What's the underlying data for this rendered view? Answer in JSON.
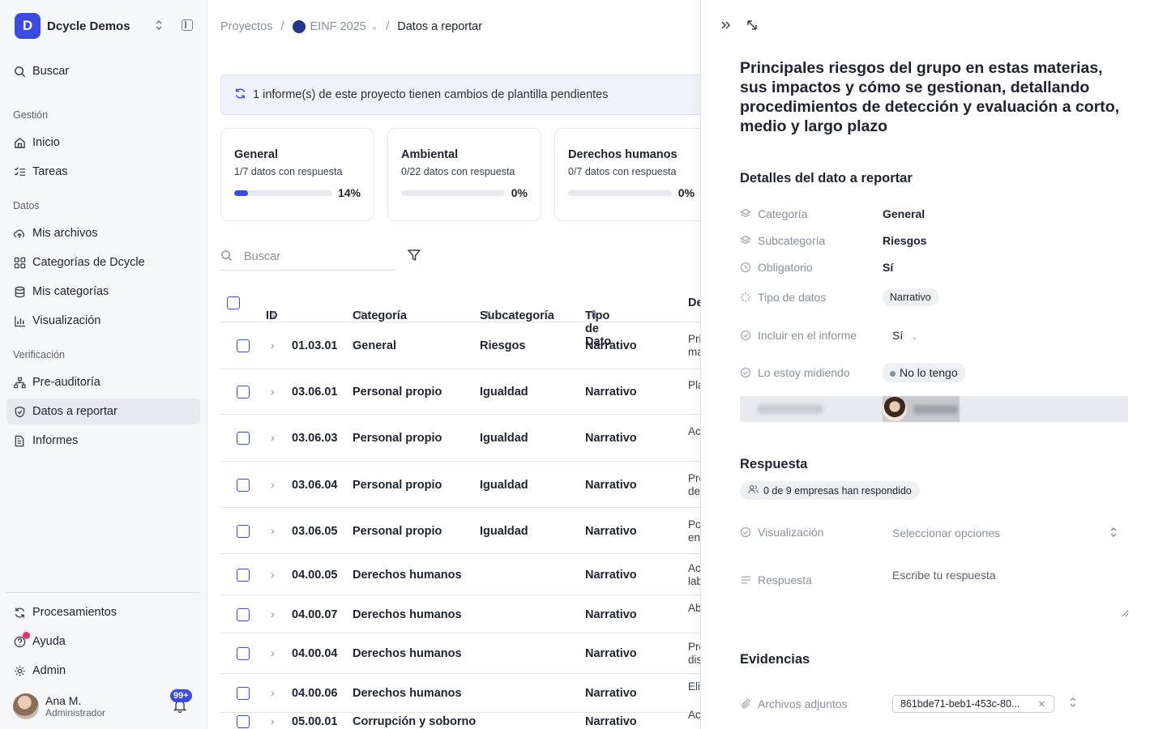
{
  "sidebar": {
    "brand": "Dcycle Demos",
    "brand_logo": "D",
    "search": "Buscar",
    "sections": [
      "Gestión",
      "Datos",
      "Verificación"
    ],
    "items": [
      {
        "label": "Inicio",
        "icon": "home-icon"
      },
      {
        "label": "Tareas",
        "icon": "checklist-icon"
      },
      {
        "label": "Mis archivos",
        "icon": "upload-cloud-icon"
      },
      {
        "label": "Categorías de Dcycle",
        "icon": "grid-icon"
      },
      {
        "label": "Mis categorías",
        "icon": "database-icon"
      },
      {
        "label": "Visualización",
        "icon": "bar-chart-icon"
      },
      {
        "label": "Pre-auditoría",
        "icon": "network-icon"
      },
      {
        "label": "Datos a reportar",
        "icon": "shield-check-icon"
      },
      {
        "label": "Informes",
        "icon": "document-icon"
      }
    ],
    "bottom": [
      {
        "label": "Procesamientos",
        "icon": "refresh-icon"
      },
      {
        "label": "Ayuda",
        "icon": "help-icon"
      },
      {
        "label": "Admin",
        "icon": "gear-icon"
      }
    ],
    "user": {
      "name": "Ana M.",
      "role": "Administrador",
      "notifications": "99+"
    }
  },
  "breadcrumb": {
    "root": "Proyectos",
    "project": "EINF 2025",
    "current": "Datos a reportar"
  },
  "notice": "1 informe(s) de este proyecto tienen cambios de plantilla pendientes",
  "cards": [
    {
      "title": "General",
      "sub": "1/7 datos con respuesta",
      "pct_label": "14%",
      "progress": 0.14
    },
    {
      "title": "Ambiental",
      "sub": "0/22 datos con respuesta",
      "pct_label": "0%",
      "progress": 0
    },
    {
      "title": "Derechos humanos",
      "sub": "0/7 datos con respuesta",
      "pct_label": "0%",
      "progress": 0
    }
  ],
  "search": {
    "placeholder": "Buscar"
  },
  "table": {
    "headers": {
      "id": "ID",
      "categoria": "Categoría",
      "subcategoria": "Subcategoría",
      "tipo": "Tipo de Dato",
      "desc": "De"
    },
    "rows": [
      {
        "id": "01.03.01",
        "categoria": "General",
        "subcategoria": "Riesgos",
        "tipo": "Narrativo",
        "desc": "Pri ma"
      },
      {
        "id": "03.06.01",
        "categoria": "Personal propio",
        "subcategoria": "Igualdad",
        "tipo": "Narrativo",
        "desc": "Pla"
      },
      {
        "id": "03.06.03",
        "categoria": "Personal propio",
        "subcategoria": "Igualdad",
        "tipo": "Narrativo",
        "desc": "Ac"
      },
      {
        "id": "03.06.04",
        "categoria": "Personal propio",
        "subcategoria": "Igualdad",
        "tipo": "Narrativo",
        "desc": "Pro de"
      },
      {
        "id": "03.06.05",
        "categoria": "Personal propio",
        "subcategoria": "Igualdad",
        "tipo": "Narrativo",
        "desc": "Po en"
      },
      {
        "id": "04.00.05",
        "categoria": "Derechos humanos",
        "subcategoria": "",
        "tipo": "Narrativo",
        "desc": "Ac lab"
      },
      {
        "id": "04.00.07",
        "categoria": "Derechos humanos",
        "subcategoria": "",
        "tipo": "Narrativo",
        "desc": "Ab"
      },
      {
        "id": "04.00.04",
        "categoria": "Derechos humanos",
        "subcategoria": "",
        "tipo": "Narrativo",
        "desc": "Pro dis"
      },
      {
        "id": "04.00.06",
        "categoria": "Derechos humanos",
        "subcategoria": "",
        "tipo": "Narrativo",
        "desc": "Eli"
      },
      {
        "id": "05.00.01",
        "categoria": "Corrupción y soborno",
        "subcategoria": "",
        "tipo": "Narrativo",
        "desc": "Ac"
      }
    ]
  },
  "panel": {
    "title": "Principales riesgos del grupo en estas materias, sus impactos y cómo se gestionan, detallando procedimientos de detección y evaluación a corto, medio y largo plazo",
    "details_heading": "Detalles del dato a reportar",
    "fields": {
      "categoria_label": "Categoría",
      "categoria": "General",
      "subcategoria_label": "Subcategoría",
      "subcategoria": "Riesgos",
      "obligatorio_label": "Obligatorio",
      "obligatorio": "Sí",
      "tipo_label": "Tipo de datos",
      "tipo": "Narrativo",
      "incluir_label": "Incluir en el informe",
      "incluir": "Sí",
      "midiendo_label": "Lo estoy midiendo",
      "midiendo": "No lo tengo"
    },
    "respuesta_heading": "Respuesta",
    "companies": "0 de 9 empresas han respondido",
    "visualizacion_label": "Visualización",
    "visualizacion_placeholder": "Seleccionar opciones",
    "respuesta_label": "Respuesta",
    "respuesta_placeholder": "Escribe tu respuesta",
    "evidencias_heading": "Evidencias",
    "archivos_label": "Archivos adjuntos",
    "file": "861bde71-beb1-453c-80..."
  },
  "colors": {
    "accent": "#3a4be0",
    "help_dot": "#e8306b"
  }
}
